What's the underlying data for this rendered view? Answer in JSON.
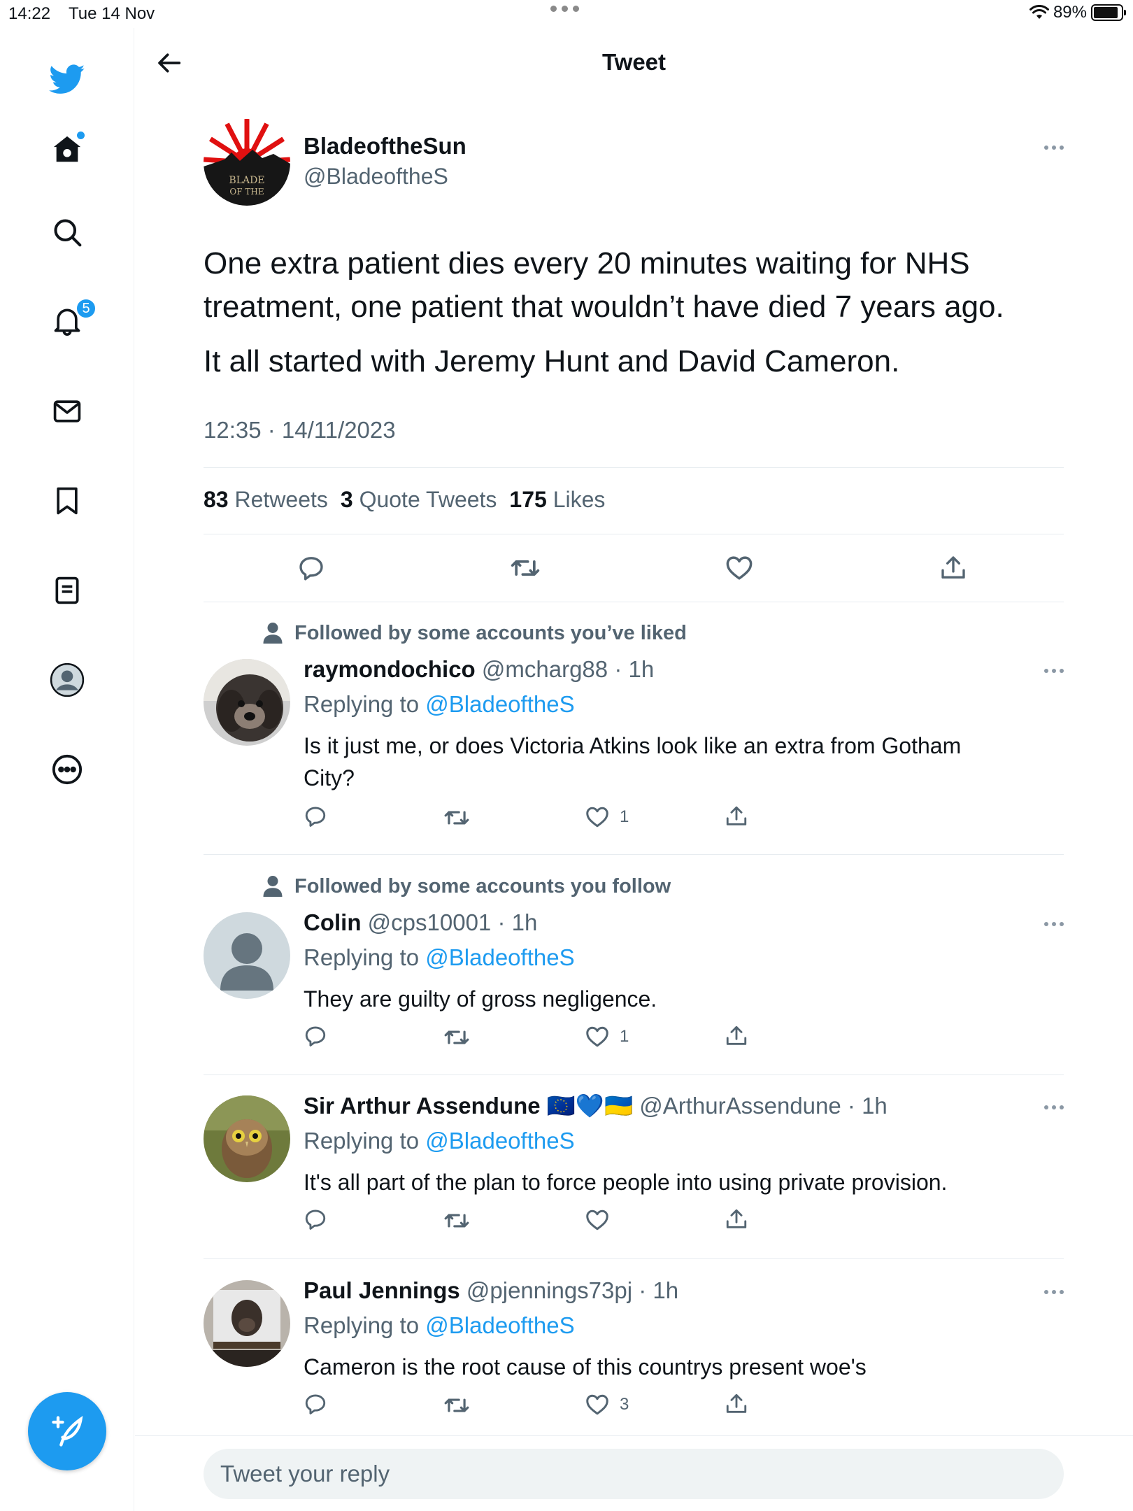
{
  "status_bar": {
    "time": "14:22",
    "date": "Tue 14 Nov",
    "battery": "89%",
    "battery_level": 0.89
  },
  "sidebar": {
    "notifications_badge": "5"
  },
  "header": {
    "title": "Tweet"
  },
  "main_tweet": {
    "name": "BladeoftheSun",
    "handle": "@BladeoftheS",
    "avatar_text": [
      "BLADE",
      "OF THE"
    ],
    "paragraphs": [
      "One extra patient dies every 20 minutes waiting for NHS treatment, one patient that wouldn’t have died 7 years ago.",
      "It all started with Jeremy Hunt and David Cameron."
    ],
    "timestamp": "12:35 · 14/11/2023",
    "stats": {
      "retweets_count": "83",
      "retweets_label": "Retweets",
      "quotes_count": "3",
      "quotes_label": "Quote Tweets",
      "likes_count": "175",
      "likes_label": "Likes"
    }
  },
  "replies": [
    {
      "social_context": "Followed by some accounts you’ve liked",
      "name": "raymondochico",
      "badges": "",
      "handle": "@mcharg88",
      "time": "· 1h",
      "replying_label": "Replying to",
      "replying_handle": "@BladeoftheS",
      "text": "Is it just me, or does Victoria Atkins look like an extra from Gotham City?",
      "likes": "1"
    },
    {
      "social_context": "Followed by some accounts you follow",
      "name": "Colin",
      "badges": "",
      "handle": "@cps10001",
      "time": "· 1h",
      "replying_label": "Replying to",
      "replying_handle": "@BladeoftheS",
      "text": "They are guilty of gross negligence.",
      "likes": "1"
    },
    {
      "social_context": "",
      "name": "Sir Arthur Assendune",
      "badges": "🇪🇺💙🇺🇦",
      "handle": "@ArthurAssendune",
      "time": "· 1h",
      "replying_label": "Replying to",
      "replying_handle": "@BladeoftheS",
      "text": "It's all part of the plan to force people into using private provision.",
      "likes": ""
    },
    {
      "social_context": "",
      "name": "Paul Jennings",
      "badges": "",
      "handle": "@pjennings73pj",
      "time": "· 1h",
      "replying_label": "Replying to",
      "replying_handle": "@BladeoftheS",
      "text": "Cameron is the root cause of this countrys present woe's",
      "likes": "3"
    }
  ],
  "reply_box": {
    "placeholder": "Tweet your reply"
  },
  "colors": {
    "accent": "#1d9bf0",
    "muted": "#536471",
    "text": "#0f1419",
    "divider": "#e7ecf0"
  },
  "icons": [
    "twitter-bird-icon",
    "home-icon",
    "search-icon",
    "bell-icon",
    "mail-icon",
    "bookmark-icon",
    "lists-icon",
    "profile-icon",
    "more-circle-icon",
    "compose-icon",
    "back-arrow-icon",
    "reply-icon",
    "retweet-icon",
    "like-icon",
    "share-icon",
    "person-icon",
    "more-icon"
  ]
}
